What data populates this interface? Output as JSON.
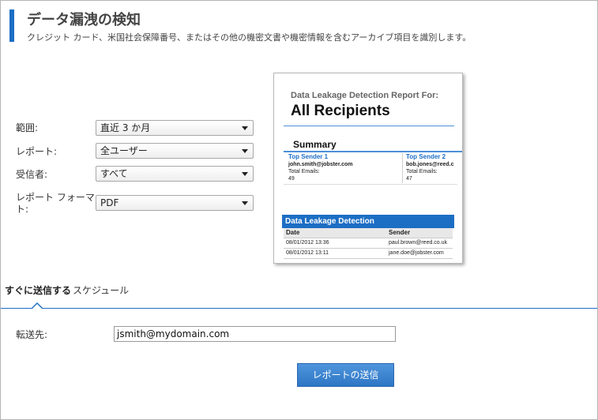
{
  "header": {
    "title": "データ漏洩の検知",
    "subtitle": "クレジット カード、米国社会保障番号、またはその他の機密文書や機密情報を含むアーカイブ項目を識別します。",
    "accent_color": "#1c6ec4"
  },
  "form": {
    "range": {
      "label": "範囲:",
      "value": "直近 3 か月"
    },
    "report": {
      "label": "レポート:",
      "value": "全ユーザー"
    },
    "recipients": {
      "label": "受信者:",
      "value": "すべて"
    },
    "format": {
      "label_line1": "レポート フォーマッ",
      "label_line2": "ト:",
      "value": "PDF"
    }
  },
  "preview": {
    "heading": "Data Leakage Detection Report For:",
    "main_title": "All Recipients",
    "summary_label": "Summary",
    "sender1": {
      "title": "Top Sender 1",
      "email": "john.smith@jobster.com",
      "total_label": "Total Emails:",
      "total": "49"
    },
    "sender2": {
      "title": "Top Sender 2",
      "email": "bob.jones@reed.c",
      "total_label": "Total Emails:",
      "total": "47"
    },
    "section_title": "Data Leakage Detection",
    "table_headers": {
      "date": "Date",
      "sender": "Sender"
    },
    "rows": [
      {
        "date": "08/01/2012 13:36",
        "sender": "paul.brown@reed.co.uk"
      },
      {
        "date": "08/01/2012 13:11",
        "sender": "jane.doe@jobster.com"
      }
    ]
  },
  "tabs": {
    "send_now": "すぐに送信する",
    "schedule": "スケジュール"
  },
  "delivery": {
    "label": "転送先:",
    "email": "jsmith@mydomain.com"
  },
  "send_button": "レポートの送信"
}
